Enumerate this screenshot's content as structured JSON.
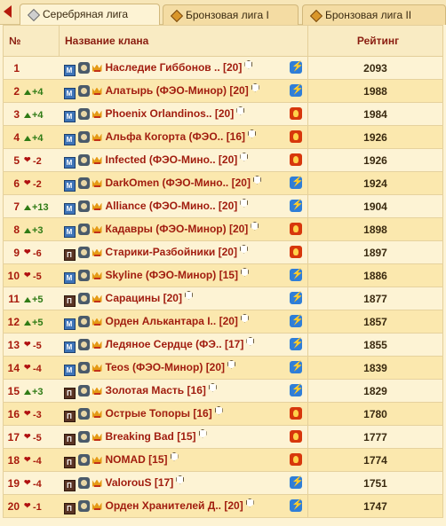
{
  "tabs": [
    {
      "label": "Серебряная лига",
      "active": true
    },
    {
      "label": "Бронзовая лига I",
      "active": false
    },
    {
      "label": "Бронзовая лига II",
      "active": false
    }
  ],
  "table": {
    "headers": {
      "num": "№",
      "name": "Название клана",
      "rating": "Рейтинг"
    },
    "rows": [
      {
        "pos": "1",
        "change": "",
        "dir": "none",
        "name": "Наследие Гиббонов ..",
        "level": "[20]",
        "league": "silver",
        "rating": "2093",
        "tag": "m"
      },
      {
        "pos": "2",
        "change": "+4",
        "dir": "up",
        "name": "Алатырь (ФЭО-Минор)",
        "level": "[20]",
        "league": "silver",
        "rating": "1988",
        "tag": "m"
      },
      {
        "pos": "3",
        "change": "+4",
        "dir": "up",
        "name": "Phoenix Orlandinos..",
        "level": "[20]",
        "league": "bronze",
        "rating": "1984",
        "tag": "m"
      },
      {
        "pos": "4",
        "change": "+4",
        "dir": "up",
        "name": "Альфа Когорта (ФЭО..",
        "level": "[16]",
        "league": "bronze",
        "rating": "1926",
        "tag": "m"
      },
      {
        "pos": "5",
        "change": "-2",
        "dir": "down",
        "name": "Infected (ФЭО-Мино..",
        "level": "[20]",
        "league": "bronze",
        "rating": "1926",
        "tag": "m"
      },
      {
        "pos": "6",
        "change": "-2",
        "dir": "down",
        "name": "DarkOmen (ФЭО-Мино..",
        "level": "[20]",
        "league": "silver",
        "rating": "1924",
        "tag": "m"
      },
      {
        "pos": "7",
        "change": "+13",
        "dir": "up",
        "name": "Alliance (ФЭО-Мино..",
        "level": "[20]",
        "league": "silver",
        "rating": "1904",
        "tag": "m"
      },
      {
        "pos": "8",
        "change": "+3",
        "dir": "up",
        "name": "Кадавры (ФЭО-Минор)",
        "level": "[20]",
        "league": "bronze",
        "rating": "1898",
        "tag": "m"
      },
      {
        "pos": "9",
        "change": "-6",
        "dir": "down",
        "name": "Старики-Разбойники",
        "level": "[20]",
        "league": "bronze",
        "rating": "1897",
        "tag": "p"
      },
      {
        "pos": "10",
        "change": "-5",
        "dir": "down",
        "name": "Skyline (ФЭО-Минор)",
        "level": "[15]",
        "league": "silver",
        "rating": "1886",
        "tag": "m"
      },
      {
        "pos": "11",
        "change": "+5",
        "dir": "up",
        "name": "Сарацины",
        "level": "[20]",
        "league": "silver",
        "rating": "1877",
        "tag": "p"
      },
      {
        "pos": "12",
        "change": "+5",
        "dir": "up",
        "name": "Орден Алькантара I..",
        "level": "[20]",
        "league": "silver",
        "rating": "1857",
        "tag": "m"
      },
      {
        "pos": "13",
        "change": "-5",
        "dir": "down",
        "name": "Ледяное Сердце (ФЭ..",
        "level": "[17]",
        "league": "silver",
        "rating": "1855",
        "tag": "m"
      },
      {
        "pos": "14",
        "change": "-4",
        "dir": "down",
        "name": "Teos (ФЭО-Минор)",
        "level": "[20]",
        "league": "silver",
        "rating": "1839",
        "tag": "m"
      },
      {
        "pos": "15",
        "change": "+3",
        "dir": "up",
        "name": "Золотая Масть",
        "level": "[16]",
        "league": "silver",
        "rating": "1829",
        "tag": "p"
      },
      {
        "pos": "16",
        "change": "-3",
        "dir": "down",
        "name": "Острые Топоры",
        "level": "[16]",
        "league": "bronze",
        "rating": "1780",
        "tag": "p"
      },
      {
        "pos": "17",
        "change": "-5",
        "dir": "down",
        "name": "Breaking Bad",
        "level": "[15]",
        "league": "bronze",
        "rating": "1777",
        "tag": "p"
      },
      {
        "pos": "18",
        "change": "-4",
        "dir": "down",
        "name": "NOMAD",
        "level": "[15]",
        "league": "bronze",
        "rating": "1774",
        "tag": "p"
      },
      {
        "pos": "19",
        "change": "-4",
        "dir": "down",
        "name": "ValorouS",
        "level": "[17]",
        "league": "silver",
        "rating": "1751",
        "tag": "p"
      },
      {
        "pos": "20",
        "change": "-1",
        "dir": "down",
        "name": "Орден Хранителей Д..",
        "level": "[20]",
        "league": "silver",
        "rating": "1747",
        "tag": "p"
      }
    ]
  },
  "colors": {
    "accent": "#a11d0f",
    "up": "#2f7b15",
    "silver_badge": "#2f7ed8",
    "bronze_badge": "#d7370c",
    "background": "#fdf3d4"
  },
  "icons": {
    "back": "left-triangle-icon",
    "tab": "diamond-emblem-icon",
    "silver": "lightning-icon",
    "bronze": "flame-icon"
  }
}
